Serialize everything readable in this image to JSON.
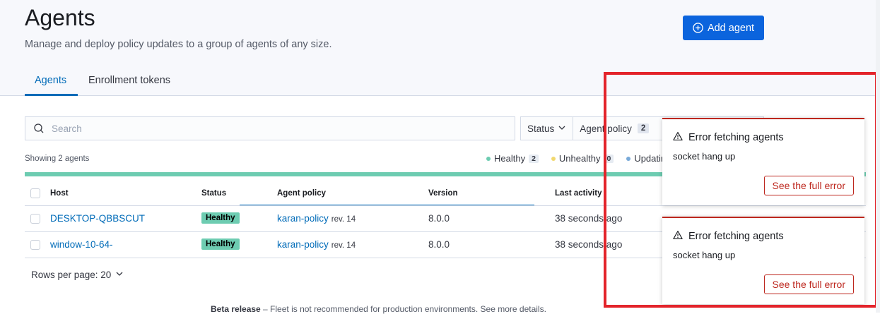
{
  "header": {
    "title": "Agents",
    "description": "Manage and deploy policy updates to a group of agents of any size.",
    "add_agent_label": "Add agent"
  },
  "tabs": [
    {
      "label": "Agents",
      "active": true
    },
    {
      "label": "Enrollment tokens",
      "active": false
    }
  ],
  "search": {
    "placeholder": "Search",
    "value": ""
  },
  "filters": {
    "status_label": "Status",
    "policy_label": "Agent policy",
    "policy_count": "2"
  },
  "summary": {
    "showing_text": "Showing 2 agents",
    "legend": [
      {
        "label": "Healthy",
        "count": "2",
        "color": "#6dccb1"
      },
      {
        "label": "Unhealthy",
        "count": "0",
        "color": "#f1d86f"
      },
      {
        "label": "Updating",
        "count": "",
        "color": "#79aad9"
      }
    ]
  },
  "table": {
    "columns": [
      "Host",
      "Status",
      "Agent policy",
      "Version",
      "Last activity"
    ],
    "rows": [
      {
        "host": "DESKTOP-QBBSCUT",
        "status": "Healthy",
        "policy": "karan-policy",
        "rev": "rev. 14",
        "version": "8.0.0",
        "last_activity": "38 seconds ago"
      },
      {
        "host": "window-10-64-",
        "status": "Healthy",
        "policy": "karan-policy",
        "rev": "rev. 14",
        "version": "8.0.0",
        "last_activity": "38 seconds ago"
      }
    ]
  },
  "pagination": {
    "rows_per_page": "Rows per page: 20"
  },
  "footer": {
    "beta_label": "Beta release",
    "beta_text": " – Fleet is not recommended for production environments. See more details."
  },
  "toasts": [
    {
      "title": "Error fetching agents",
      "body": "socket hang up",
      "button": "See the full error"
    },
    {
      "title": "Error fetching agents",
      "body": "socket hang up",
      "button": "See the full error"
    }
  ],
  "colors": {
    "primary": "#0b64dd",
    "link": "#006bb8",
    "healthy": "#6dccb1",
    "danger": "#bd271e",
    "annotation": "#e3242b"
  }
}
